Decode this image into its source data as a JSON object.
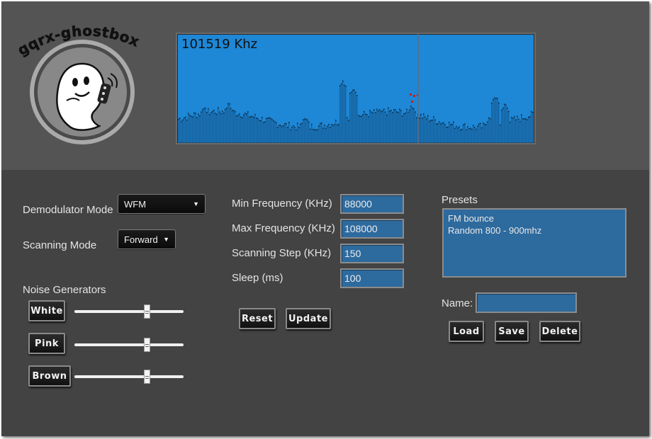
{
  "app": {
    "logo_text": "gqrx-ghostbox"
  },
  "spectrum": {
    "frequency_readout": "101519 Khz",
    "background_color": "#1e87d6",
    "cursor_position": 0.675
  },
  "controls": {
    "demod_label": "Demodulator Mode",
    "demod_value": "WFM",
    "scan_label": "Scanning Mode",
    "scan_value": "Forward",
    "noise_label": "Noise Generators",
    "noise": [
      {
        "label": "White",
        "level": 0.67
      },
      {
        "label": "Pink",
        "level": 0.67
      },
      {
        "label": "Brown",
        "level": 0.67
      }
    ]
  },
  "frequency": {
    "min_label": "Min Frequency (KHz)",
    "min_value": "88000",
    "max_label": "Max Frequency (KHz)",
    "max_value": "108000",
    "step_label": "Scanning Step (KHz)",
    "step_value": "150",
    "sleep_label": "Sleep (ms)",
    "sleep_value": "100",
    "reset_label": "Reset",
    "update_label": "Update"
  },
  "presets": {
    "title": "Presets",
    "items": [
      "FM bounce",
      "Random 800 - 900mhz"
    ],
    "name_label": "Name:",
    "name_value": "",
    "load_label": "Load",
    "save_label": "Save",
    "delete_label": "Delete"
  }
}
